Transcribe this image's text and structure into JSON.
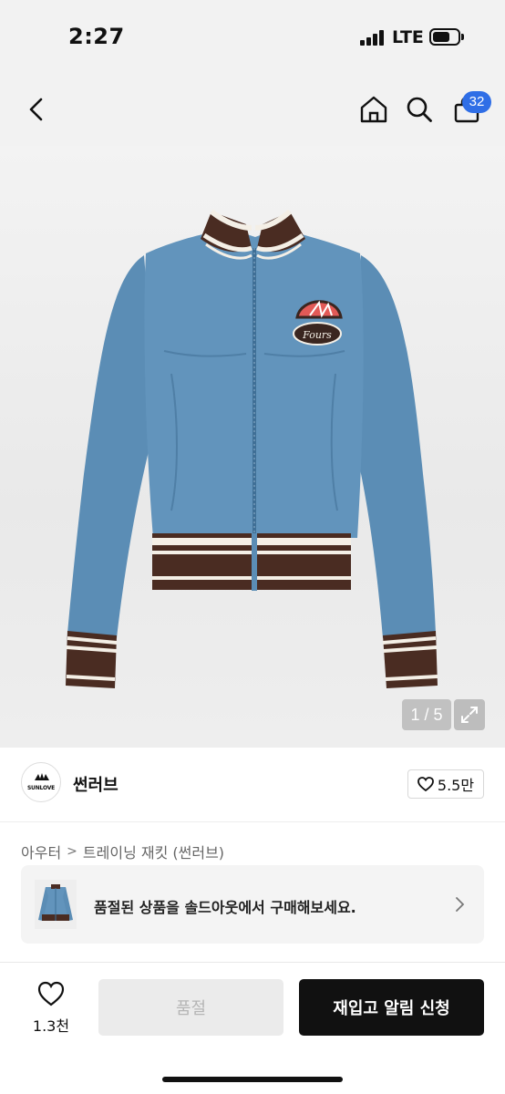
{
  "status_bar": {
    "time": "2:27",
    "network": "LTE"
  },
  "nav": {
    "cart_count": "32"
  },
  "product": {
    "pager": "1 / 5"
  },
  "brand": {
    "logo_text": "SUNLOVE",
    "name": "썬러브",
    "likes": "5.5만"
  },
  "breadcrumb": {
    "category": "아우터",
    "separator": ">",
    "product": "트레이닝 재킷 (썬러브)"
  },
  "soldout_banner": {
    "text": "품절된 상품을 솔드아웃에서 구매해보세요."
  },
  "bottom_bar": {
    "wish_count": "1.3천",
    "soldout_label": "품절",
    "restock_label": "재입고 알림 신청"
  },
  "colors": {
    "accent": "#2f6ee6",
    "jacket": "#5b8db5",
    "stripe": "#4a2c22",
    "primary_button": "#111111"
  },
  "icons": [
    "back-icon",
    "home-icon",
    "search-icon",
    "cart-icon",
    "expand-icon",
    "heart-icon",
    "chevron-right-icon"
  ]
}
